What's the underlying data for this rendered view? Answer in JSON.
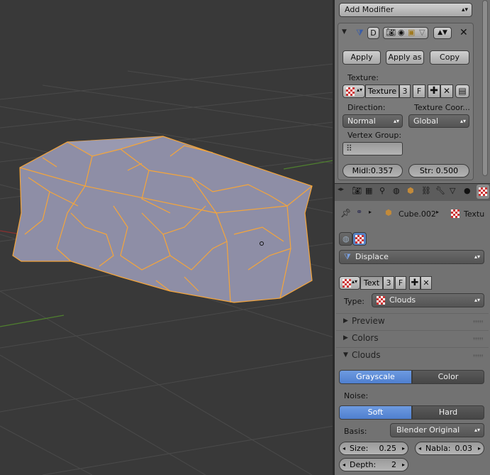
{
  "modifier_panel": {
    "add_modifier_label": "Add Modifier",
    "apply_label": "Apply",
    "apply_as_label": "Apply as",
    "copy_label": "Copy",
    "texture_heading": "Texture:",
    "texture_name": "Texture",
    "texture_users": "3",
    "fake_user": "F",
    "direction_heading": "Direction:",
    "direction_value": "Normal",
    "texture_coords_heading": "Texture Coor...",
    "texture_coords_value": "Global",
    "vertex_group_heading": "Vertex Group:",
    "midlevel_label": "Midl:",
    "midlevel_value": "0.357",
    "strength_label": "Str:",
    "strength_value": "0.500",
    "d_label": "D"
  },
  "texture_panel": {
    "breadcrumb_object": "Cube.002",
    "breadcrumb_texture": "Textu",
    "modifier_select": "Displace",
    "texture_name": "Text",
    "texture_users": "3",
    "fake_user": "F",
    "type_label": "Type:",
    "type_value": "Clouds",
    "sections": {
      "preview": "Preview",
      "colors": "Colors",
      "clouds": "Clouds"
    },
    "grayscale_label": "Grayscale",
    "color_label": "Color",
    "noise_heading": "Noise:",
    "soft_label": "Soft",
    "hard_label": "Hard",
    "basis_label": "Basis:",
    "basis_value": "Blender Original",
    "size_label": "Size:",
    "size_value": "0.25",
    "nabla_label": "Nabla:",
    "nabla_value": "0.03",
    "depth_label": "Depth:",
    "depth_value": "2"
  },
  "colors": {
    "viewport_bg": "#393939",
    "grid": "#4a4a4a",
    "mesh_fill": "#8e8ea6",
    "selection": "#f5a53a",
    "panel_bg": "#727272",
    "active_blue": "#5680c2"
  },
  "icons": [
    "triangle-down-icon",
    "filter-icon",
    "camera-icon",
    "eye-icon",
    "editmode-icon",
    "cage-icon",
    "move-up-down-icon",
    "close-icon",
    "checker-texture-icon",
    "plus-icon",
    "x-icon",
    "browse-icon",
    "vertex-group-icon",
    "pin-icon",
    "object-icon",
    "cube-icon",
    "render-icon",
    "scene-icon",
    "world-icon",
    "constraint-icon",
    "modifier-icon",
    "data-icon",
    "material-icon",
    "texture-icon"
  ]
}
